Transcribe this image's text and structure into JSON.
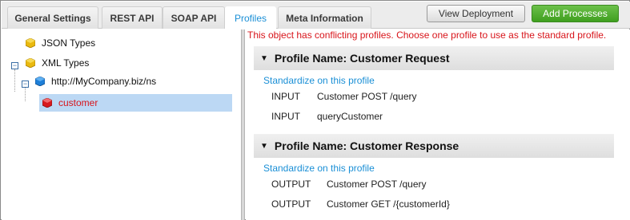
{
  "tabs": [
    {
      "label": "General Settings",
      "active": false
    },
    {
      "label": "REST API",
      "active": false
    },
    {
      "label": "SOAP API",
      "active": false
    },
    {
      "label": "Profiles",
      "active": true
    },
    {
      "label": "Meta Information",
      "active": false
    }
  ],
  "actions": {
    "view_deployment": "View Deployment",
    "add_processes": "Add Processes"
  },
  "tree": {
    "json_types": {
      "label": "JSON Types",
      "icon": "yellow-cube-icon"
    },
    "xml_types": {
      "label": "XML Types",
      "icon": "yellow-cube-icon",
      "expanded": true
    },
    "namespace": {
      "label": "http://MyCompany.biz/ns",
      "icon": "blue-cube-icon",
      "expanded": true
    },
    "customer": {
      "label": "customer",
      "icon": "red-cube-icon",
      "selected": true
    }
  },
  "conflict_message": "This object has conflicting profiles. Choose one profile to use as the standard profile.",
  "profiles": [
    {
      "header": "Profile Name: Customer Request",
      "standardize_link": "Standardize on this profile",
      "rows": [
        {
          "direction": "INPUT",
          "value": "Customer POST /query"
        },
        {
          "direction": "INPUT",
          "value": "queryCustomer"
        }
      ]
    },
    {
      "header": "Profile Name: Customer Response",
      "standardize_link": "Standardize on this profile",
      "rows": [
        {
          "direction": "OUTPUT",
          "value": "Customer POST /query"
        },
        {
          "direction": "OUTPUT",
          "value": "Customer GET /{customerId}"
        }
      ]
    }
  ],
  "colors": {
    "accent": "#1a8fd6",
    "conflict": "#d8141a",
    "add_button": "#4fae2c",
    "selection": "#bcd8f4"
  }
}
